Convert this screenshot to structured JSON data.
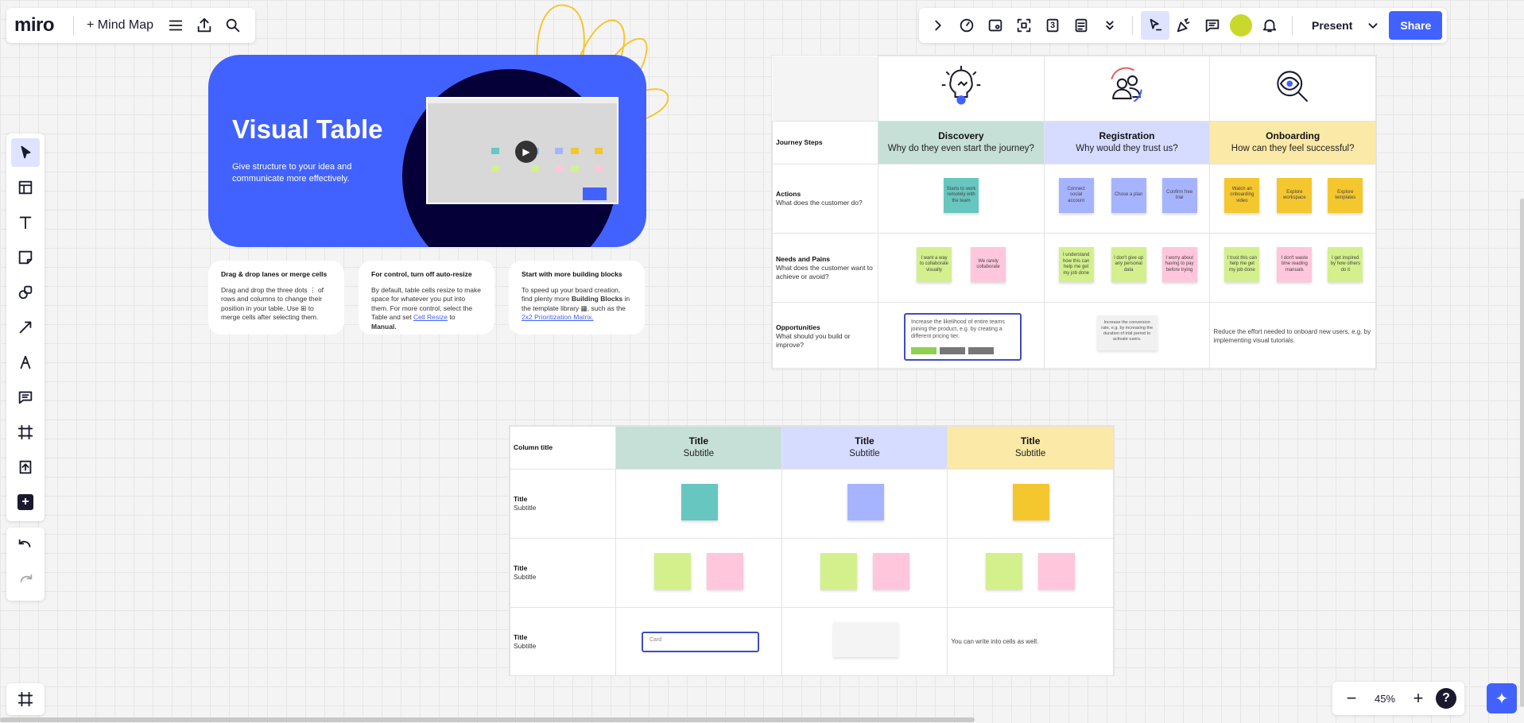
{
  "topbar_left": {
    "logo": "miro",
    "mind_map_label": "+ Mind Map"
  },
  "topbar_right": {
    "tool_count": "3",
    "present_label": "Present",
    "share_label": "Share"
  },
  "zoom": {
    "value": "45%",
    "minus": "−",
    "plus": "+",
    "help": "?"
  },
  "hero": {
    "title": "Visual Table",
    "subtitle": "Give structure to your idea and communicate more effectively."
  },
  "tips": [
    {
      "title": "Drag & drop lanes or merge cells",
      "text_1": "Drag and drop the three dots",
      "text_2": "of rows and columns to change their position in your table. Use",
      "text_3": "to merge cells after selecting them."
    },
    {
      "title": "For control, turn off auto-resize",
      "text_1": "By default, table cells resize to make space for whatever you put into them. For more control, select the Table and set",
      "link": "Cell Resize",
      "text_2": "to",
      "bold": "Manual."
    },
    {
      "title": "Start with more building blocks",
      "text_1": "To speed up your board creation, find plenty more",
      "bold": "Building Blocks",
      "text_2": "in the template library",
      "text_3": ", such as the",
      "link": "2x2 Prioritization Matrix."
    }
  ],
  "journey_table": {
    "columns": [
      {
        "title": "Discovery",
        "subtitle": "Why do they even start the journey?"
      },
      {
        "title": "Registration",
        "subtitle": "Why would they trust us?"
      },
      {
        "title": "Onboarding",
        "subtitle": "How can they feel successful?"
      }
    ],
    "rows": [
      {
        "title": "Journey Steps",
        "subtitle": ""
      },
      {
        "title": "Actions",
        "subtitle": "What does the customer do?"
      },
      {
        "title": "Needs and Pains",
        "subtitle": "What does the customer want to achieve or avoid?"
      },
      {
        "title": "Opportunities",
        "subtitle": "What should you build or improve?"
      }
    ],
    "actions": {
      "discovery": [
        "Starts to work remotely with the team"
      ],
      "registration": [
        "Connect social account",
        "Chose a plan",
        "Confirm free trial"
      ],
      "onboarding": [
        "Watch an onboarding video",
        "Explore workspace",
        "Explore templates"
      ]
    },
    "needs": {
      "discovery": [
        "I want a way to collaborate visually",
        "We rarely collaborate"
      ],
      "registration": [
        "I understand how this can help me get my job done",
        "I don't give up any personal data",
        "I worry about having to pay before trying"
      ],
      "onboarding": [
        "I trust this can help me get my job done",
        "I don't waste time reading manuals",
        "I get inspired by how others do it"
      ]
    },
    "opportunities": {
      "discovery": "Increase the likelihood of entire teams joining the product, e.g. by creating a different pricing tier.",
      "registration": "Increase the conversion rate, e.g. by increasing the duration of trial period to activate users.",
      "onboarding": "Reduce the effort needed to onboard new users, e.g. by implementing visual tutorials."
    }
  },
  "template_table": {
    "corner": "Column title",
    "columns": [
      {
        "title": "Title",
        "subtitle": "Subtitle"
      },
      {
        "title": "Title",
        "subtitle": "Subtitle"
      },
      {
        "title": "Title",
        "subtitle": "Subtitle"
      }
    ],
    "rows": [
      {
        "title": "Title",
        "subtitle": "Subtitle"
      },
      {
        "title": "Title",
        "subtitle": "Subtitle"
      },
      {
        "title": "Title",
        "subtitle": "Subtitle"
      }
    ],
    "card_placeholder": "Card",
    "cell_text": "You can write into cells as well."
  },
  "colors": {
    "accent": "#4262ff",
    "hero_dark": "#050038",
    "discovery_header": "#c6e0d8",
    "registration_header": "#d6dcff",
    "onboarding_header": "#fbe9a7"
  },
  "icons": {
    "top_left": [
      "menu-icon",
      "export-icon",
      "search-icon"
    ],
    "top_right": [
      "chevron-right-icon",
      "timer-icon",
      "board-icon",
      "focus-icon",
      "count-icon",
      "notes-icon",
      "chevron-double-down-icon",
      "cursor-collab-icon",
      "celebrate-icon",
      "comment-icon",
      "bell-icon"
    ],
    "left_tools": [
      "select-icon",
      "templates-icon",
      "text-icon",
      "sticky-note-icon",
      "shapes-icon",
      "connector-icon",
      "pen-icon",
      "comment-icon",
      "frame-icon",
      "upload-icon",
      "more-icon"
    ]
  }
}
